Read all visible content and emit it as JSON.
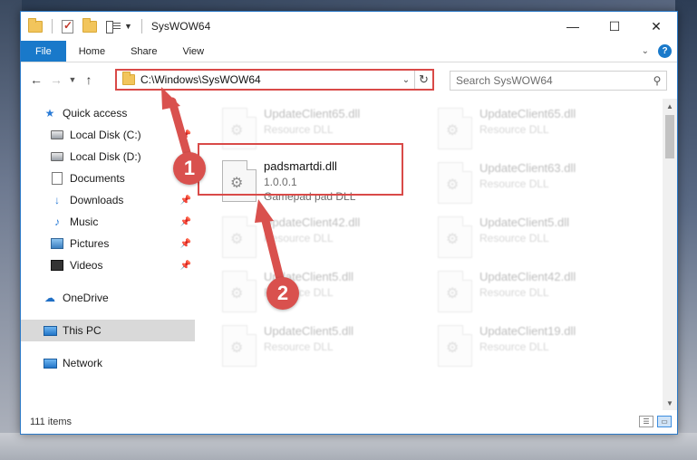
{
  "window": {
    "title": "SysWOW64"
  },
  "ribbon": {
    "tabs": [
      "File",
      "Home",
      "Share",
      "View"
    ]
  },
  "address": {
    "path": "C:\\Windows\\SysWOW64",
    "search_placeholder": "Search SysWOW64"
  },
  "nav": {
    "quick_access": "Quick access",
    "items": [
      {
        "label": "Local Disk (C:)",
        "icon": "drive-icon"
      },
      {
        "label": "Local Disk (D:)",
        "icon": "drive-icon"
      },
      {
        "label": "Documents",
        "icon": "documents-icon"
      },
      {
        "label": "Downloads",
        "icon": "downloads-icon"
      },
      {
        "label": "Music",
        "icon": "music-icon"
      },
      {
        "label": "Pictures",
        "icon": "pictures-icon"
      },
      {
        "label": "Videos",
        "icon": "videos-icon"
      }
    ],
    "onedrive": "OneDrive",
    "this_pc": "This PC",
    "network": "Network"
  },
  "files": {
    "highlighted": {
      "name": "padsmartdi.dll",
      "version": "1.0.0.1",
      "description": "Gamepad pad DLL"
    },
    "faded": [
      {
        "name": "UpdateClient65.dll",
        "type": "Resource DLL"
      },
      {
        "name": "UpdateClient65.dll",
        "type": "Resource DLL"
      },
      {
        "name": "UpdateClient63.dll",
        "type": "Resource DLL"
      },
      {
        "name": "UpdateClient42.dll",
        "type": "Resource DLL"
      },
      {
        "name": "UpdateClient5.dll",
        "type": "Resource DLL"
      },
      {
        "name": "UpdateClient5.dll",
        "type": "Resource DLL"
      },
      {
        "name": "UpdateClient42.dll",
        "type": "Resource DLL"
      },
      {
        "name": "UpdateClient5.dll",
        "type": "Resource DLL"
      },
      {
        "name": "UpdateClient19.dll",
        "type": "Resource DLL"
      }
    ]
  },
  "status": {
    "item_count": "111 items"
  },
  "callouts": {
    "one": "1",
    "two": "2"
  },
  "colors": {
    "accent": "#1979ca",
    "callout": "#d9514e"
  }
}
